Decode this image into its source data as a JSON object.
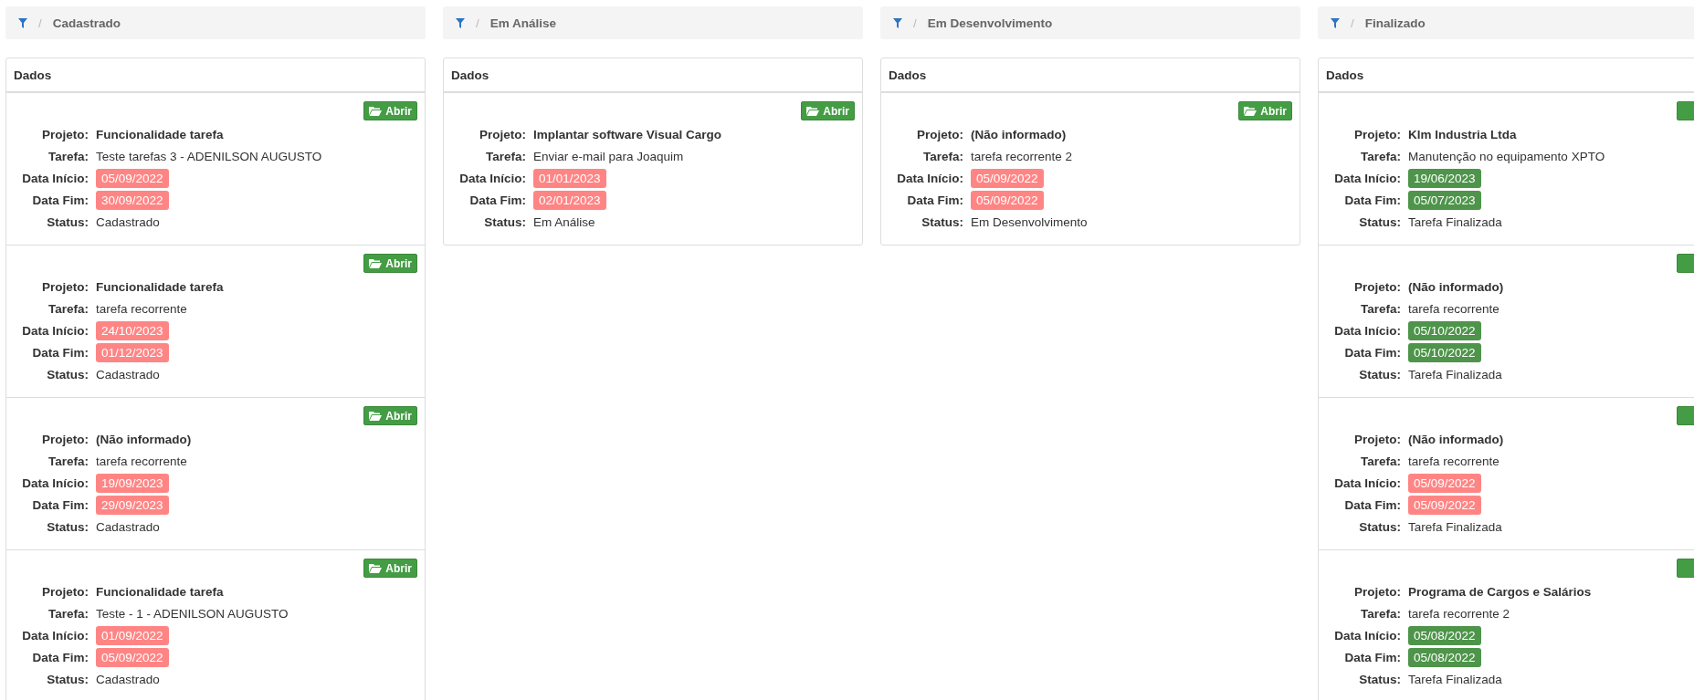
{
  "columns": [
    {
      "separator": "/",
      "title": "Cadastrado",
      "panel_title": "Dados",
      "cards": [
        {
          "button": "Abrir",
          "fields": [
            {
              "label": "Projeto:",
              "value": "Funcionalidade tarefa",
              "kind": "bold"
            },
            {
              "label": "Tarefa:",
              "value": "Teste tarefas 3 - ADENILSON AUGUSTO",
              "kind": "text"
            },
            {
              "label": "Data Início:",
              "value": "05/09/2022",
              "kind": "date",
              "color": "#ff8585"
            },
            {
              "label": "Data Fim:",
              "value": "30/09/2022",
              "kind": "date",
              "color": "#ff8585"
            },
            {
              "label": "Status:",
              "value": "Cadastrado",
              "kind": "text"
            }
          ]
        },
        {
          "button": "Abrir",
          "fields": [
            {
              "label": "Projeto:",
              "value": "Funcionalidade tarefa",
              "kind": "bold"
            },
            {
              "label": "Tarefa:",
              "value": "tarefa recorrente",
              "kind": "text"
            },
            {
              "label": "Data Início:",
              "value": "24/10/2023",
              "kind": "date",
              "color": "#ff8585"
            },
            {
              "label": "Data Fim:",
              "value": "01/12/2023",
              "kind": "date",
              "color": "#ff8585"
            },
            {
              "label": "Status:",
              "value": "Cadastrado",
              "kind": "text"
            }
          ]
        },
        {
          "button": "Abrir",
          "fields": [
            {
              "label": "Projeto:",
              "value": "(Não informado)",
              "kind": "bold"
            },
            {
              "label": "Tarefa:",
              "value": "tarefa recorrente",
              "kind": "text"
            },
            {
              "label": "Data Início:",
              "value": "19/09/2023",
              "kind": "date",
              "color": "#ff8585"
            },
            {
              "label": "Data Fim:",
              "value": "29/09/2023",
              "kind": "date",
              "color": "#ff8585"
            },
            {
              "label": "Status:",
              "value": "Cadastrado",
              "kind": "text"
            }
          ]
        },
        {
          "button": "Abrir",
          "fields": [
            {
              "label": "Projeto:",
              "value": "Funcionalidade tarefa",
              "kind": "bold"
            },
            {
              "label": "Tarefa:",
              "value": "Teste - 1 - ADENILSON AUGUSTO",
              "kind": "text"
            },
            {
              "label": "Data Início:",
              "value": "01/09/2022",
              "kind": "date",
              "color": "#ff8585"
            },
            {
              "label": "Data Fim:",
              "value": "05/09/2022",
              "kind": "date",
              "color": "#ff8585"
            },
            {
              "label": "Status:",
              "value": "Cadastrado",
              "kind": "text"
            }
          ]
        }
      ]
    },
    {
      "separator": "/",
      "title": "Em Análise",
      "panel_title": "Dados",
      "cards": [
        {
          "button": "Abrir",
          "fields": [
            {
              "label": "Projeto:",
              "value": "Implantar software Visual Cargo",
              "kind": "bold"
            },
            {
              "label": "Tarefa:",
              "value": "Enviar e-mail para Joaquim",
              "kind": "text"
            },
            {
              "label": "Data Início:",
              "value": "01/01/2023",
              "kind": "date",
              "color": "#ff8585"
            },
            {
              "label": "Data Fim:",
              "value": "02/01/2023",
              "kind": "date",
              "color": "#ff8585"
            },
            {
              "label": "Status:",
              "value": "Em Análise",
              "kind": "text"
            }
          ]
        }
      ]
    },
    {
      "separator": "/",
      "title": "Em Desenvolvimento",
      "panel_title": "Dados",
      "cards": [
        {
          "button": "Abrir",
          "fields": [
            {
              "label": "Projeto:",
              "value": "(Não informado)",
              "kind": "bold"
            },
            {
              "label": "Tarefa:",
              "value": "tarefa recorrente 2",
              "kind": "text"
            },
            {
              "label": "Data Início:",
              "value": "05/09/2022",
              "kind": "date",
              "color": "#ff8585"
            },
            {
              "label": "Data Fim:",
              "value": "05/09/2022",
              "kind": "date",
              "color": "#ff8585"
            },
            {
              "label": "Status:",
              "value": "Em Desenvolvimento",
              "kind": "text"
            }
          ]
        }
      ]
    },
    {
      "separator": "/",
      "title": "Finalizado",
      "panel_title": "Dados",
      "cards": [
        {
          "fields": [
            {
              "label": "Projeto:",
              "value": "Klm Industria Ltda",
              "kind": "bold"
            },
            {
              "label": "Tarefa:",
              "value": "Manutenção no equipamento XPTO",
              "kind": "text"
            },
            {
              "label": "Data Início:",
              "value": "19/06/2023",
              "kind": "date",
              "color": "#4e944a"
            },
            {
              "label": "Data Fim:",
              "value": "05/07/2023",
              "kind": "date",
              "color": "#4e944a"
            },
            {
              "label": "Status:",
              "value": "Tarefa Finalizada",
              "kind": "text"
            }
          ]
        },
        {
          "fields": [
            {
              "label": "Projeto:",
              "value": "(Não informado)",
              "kind": "bold"
            },
            {
              "label": "Tarefa:",
              "value": "tarefa recorrente",
              "kind": "text"
            },
            {
              "label": "Data Início:",
              "value": "05/10/2022",
              "kind": "date",
              "color": "#4e944a"
            },
            {
              "label": "Data Fim:",
              "value": "05/10/2022",
              "kind": "date",
              "color": "#4e944a"
            },
            {
              "label": "Status:",
              "value": "Tarefa Finalizada",
              "kind": "text"
            }
          ]
        },
        {
          "fields": [
            {
              "label": "Projeto:",
              "value": "(Não informado)",
              "kind": "bold"
            },
            {
              "label": "Tarefa:",
              "value": "tarefa recorrente",
              "kind": "text"
            },
            {
              "label": "Data Início:",
              "value": "05/09/2022",
              "kind": "date",
              "color": "#ff8585"
            },
            {
              "label": "Data Fim:",
              "value": "05/09/2022",
              "kind": "date",
              "color": "#ff8585"
            },
            {
              "label": "Status:",
              "value": "Tarefa Finalizada",
              "kind": "text"
            }
          ]
        },
        {
          "fields": [
            {
              "label": "Projeto:",
              "value": "Programa de Cargos e Salários",
              "kind": "bold"
            },
            {
              "label": "Tarefa:",
              "value": "tarefa recorrente 2",
              "kind": "text"
            },
            {
              "label": "Data Início:",
              "value": "05/08/2022",
              "kind": "date",
              "color": "#4e944a"
            },
            {
              "label": "Data Fim:",
              "value": "05/08/2022",
              "kind": "date",
              "color": "#4e944a"
            },
            {
              "label": "Status:",
              "value": "Tarefa Finalizada",
              "kind": "text"
            }
          ]
        }
      ]
    }
  ]
}
